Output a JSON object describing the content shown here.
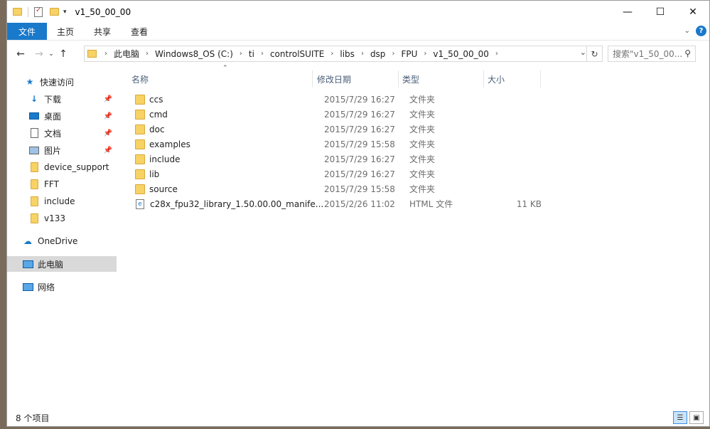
{
  "window": {
    "title": "v1_50_00_00"
  },
  "ribbon": {
    "tabs": [
      "文件",
      "主页",
      "共享",
      "查看"
    ]
  },
  "address": {
    "crumbs": [
      "此电脑",
      "Windows8_OS (C:)",
      "ti",
      "controlSUITE",
      "libs",
      "dsp",
      "FPU",
      "v1_50_00_00"
    ]
  },
  "search": {
    "placeholder": "搜索\"v1_50_00..."
  },
  "nav": {
    "quick_access": "快速访问",
    "pinned": [
      "下载",
      "桌面",
      "文档",
      "图片"
    ],
    "recent": [
      "device_support",
      "FFT",
      "include",
      "v133"
    ],
    "onedrive": "OneDrive",
    "this_pc": "此电脑",
    "network": "网络"
  },
  "columns": {
    "name": "名称",
    "date": "修改日期",
    "type": "类型",
    "size": "大小"
  },
  "files": [
    {
      "name": "ccs",
      "date": "2015/7/29 16:27",
      "type": "文件夹",
      "size": "",
      "icon": "folder-icon"
    },
    {
      "name": "cmd",
      "date": "2015/7/29 16:27",
      "type": "文件夹",
      "size": "",
      "icon": "folder-icon"
    },
    {
      "name": "doc",
      "date": "2015/7/29 16:27",
      "type": "文件夹",
      "size": "",
      "icon": "folder-icon"
    },
    {
      "name": "examples",
      "date": "2015/7/29 15:58",
      "type": "文件夹",
      "size": "",
      "icon": "folder-icon"
    },
    {
      "name": "include",
      "date": "2015/7/29 16:27",
      "type": "文件夹",
      "size": "",
      "icon": "folder-icon"
    },
    {
      "name": "lib",
      "date": "2015/7/29 16:27",
      "type": "文件夹",
      "size": "",
      "icon": "folder-icon"
    },
    {
      "name": "source",
      "date": "2015/7/29 15:58",
      "type": "文件夹",
      "size": "",
      "icon": "folder-icon"
    },
    {
      "name": "c28x_fpu32_library_1.50.00.00_manife...",
      "date": "2015/2/26 11:02",
      "type": "HTML 文件",
      "size": "11 KB",
      "icon": "html-file-icon"
    }
  ],
  "status": {
    "count": "8 个项目"
  },
  "colors": {
    "accent": "#1979ca",
    "folder": "#f7d264",
    "selected": "#d9d9d9"
  }
}
